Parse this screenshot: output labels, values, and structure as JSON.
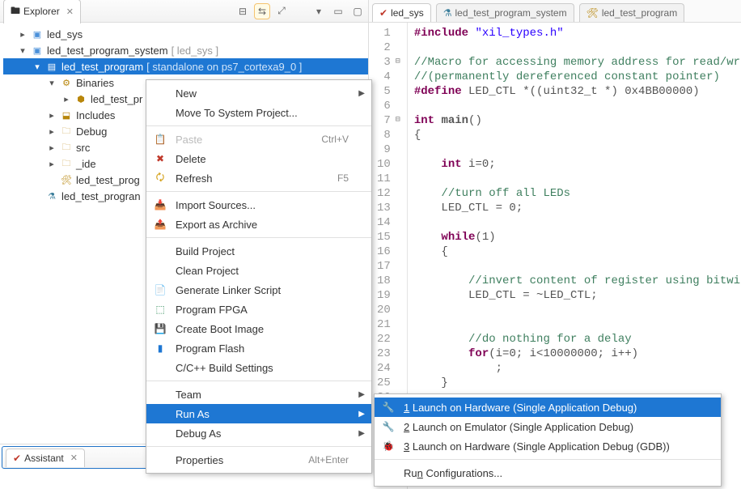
{
  "explorer": {
    "title": "Explorer",
    "nodes": {
      "led_sys": "led_sys",
      "system": "led_test_program_system",
      "system_suffix": " [ led_sys ]",
      "prog": "led_test_program",
      "prog_suffix": " [ standalone on ps7_cortexa9_0 ]",
      "binaries": "Binaries",
      "binaries_child": "led_test_pr",
      "includes": "Includes",
      "debug": "Debug",
      "src": "src",
      "ide": "_ide",
      "prog_prj": "led_test_prog",
      "prog_bottom": "led_test_progran"
    },
    "toolbar": {
      "collapse": "⊟",
      "link": "⇆",
      "focus": "⤢",
      "menu": "▾",
      "min": "▭",
      "max": "▢"
    }
  },
  "context_menu": {
    "items": [
      {
        "label": "New",
        "arrow": true
      },
      {
        "label": "Move To System Project..."
      },
      {
        "sep": true
      },
      {
        "icon": "📋",
        "label": "Paste",
        "shortcut": "Ctrl+V",
        "disabled": true
      },
      {
        "icon": "✖",
        "label": "Delete",
        "iconColor": "#c0392b"
      },
      {
        "icon": "🗘",
        "label": "Refresh",
        "shortcut": "F5",
        "iconColor": "#d4a017"
      },
      {
        "sep": true
      },
      {
        "icon": "📥",
        "label": "Import Sources..."
      },
      {
        "icon": "📤",
        "label": "Export as Archive"
      },
      {
        "sep": true
      },
      {
        "label": "Build Project"
      },
      {
        "label": "Clean Project"
      },
      {
        "icon": "📄",
        "label": "Generate Linker Script"
      },
      {
        "icon": "⬚",
        "label": "Program FPGA",
        "iconColor": "#2e8b57"
      },
      {
        "icon": "💾",
        "label": "Create Boot Image"
      },
      {
        "icon": "▮",
        "label": "Program Flash",
        "iconColor": "#1e77d3"
      },
      {
        "label": "C/C++ Build Settings"
      },
      {
        "sep": true
      },
      {
        "label": "Team",
        "arrow": true
      },
      {
        "label": "Run As",
        "arrow": true,
        "selected": true
      },
      {
        "label": "Debug As",
        "arrow": true
      },
      {
        "sep": true
      },
      {
        "label": "Properties",
        "shortcut": "Alt+Enter"
      }
    ]
  },
  "submenu": {
    "items": [
      {
        "icon": "🔧",
        "num": "1",
        "label": " Launch on Hardware (Single Application Debug)",
        "selected": true,
        "iconColor": "#c0392b"
      },
      {
        "icon": "🔧",
        "num": "2",
        "label": " Launch on Emulator (Single Application Debug)",
        "iconColor": "#c0392b"
      },
      {
        "icon": "🐞",
        "num": "3",
        "label": " Launch on Hardware (Single Application Debug (GDB))",
        "iconColor": "#2e8b57"
      },
      {
        "sep": true
      },
      {
        "label": "Run Configurations...",
        "mnemonic": "n"
      }
    ]
  },
  "editor": {
    "tabs": [
      {
        "icon": "✔",
        "label": "led_sys",
        "iconColor": "#c0392b"
      },
      {
        "icon": "⚗",
        "label": "led_test_program_system",
        "iconColor": "#3b7e9b"
      },
      {
        "icon": "🛠",
        "label": "led_test_program",
        "iconColor": "#b8860b"
      }
    ],
    "lines": [
      {
        "html": "<span class='pp'>#include</span> <span class='str'>\"xil_types.h\"</span>"
      },
      {
        "html": ""
      },
      {
        "html": "<span class='cm'>//Macro for accessing memory address for read/write</span>",
        "fold": "⊟"
      },
      {
        "html": "<span class='cm'>//(permanently dereferenced constant pointer)</span>"
      },
      {
        "html": "<span class='pp'>#define</span> LED_CTL *((uint32_t *) 0x4BB00000)"
      },
      {
        "html": ""
      },
      {
        "html": "<span class='kw'>int</span> <span style='font-weight:bold'>main</span>()",
        "fold": "⊟"
      },
      {
        "html": "{"
      },
      {
        "html": ""
      },
      {
        "html": "    <span class='kw'>int</span> i=0;"
      },
      {
        "html": ""
      },
      {
        "html": "    <span class='cm'>//turn off all LEDs</span>"
      },
      {
        "html": "    LED_CTL = 0;"
      },
      {
        "html": ""
      },
      {
        "html": "    <span class='kw'>while</span>(1)"
      },
      {
        "html": "    {"
      },
      {
        "html": ""
      },
      {
        "html": "        <span class='cm'>//invert content of register using bitwise in</span>"
      },
      {
        "html": "        LED_CTL = ~LED_CTL;"
      },
      {
        "html": ""
      },
      {
        "html": ""
      },
      {
        "html": "        <span class='cm'>//do nothing for a delay</span>"
      },
      {
        "html": "        <span class='kw'>for</span>(i=0; i&lt;10000000; i++)"
      },
      {
        "html": "            ;"
      },
      {
        "html": "    }"
      },
      {
        "html": ""
      }
    ]
  },
  "assistant": {
    "title": "Assistant"
  }
}
